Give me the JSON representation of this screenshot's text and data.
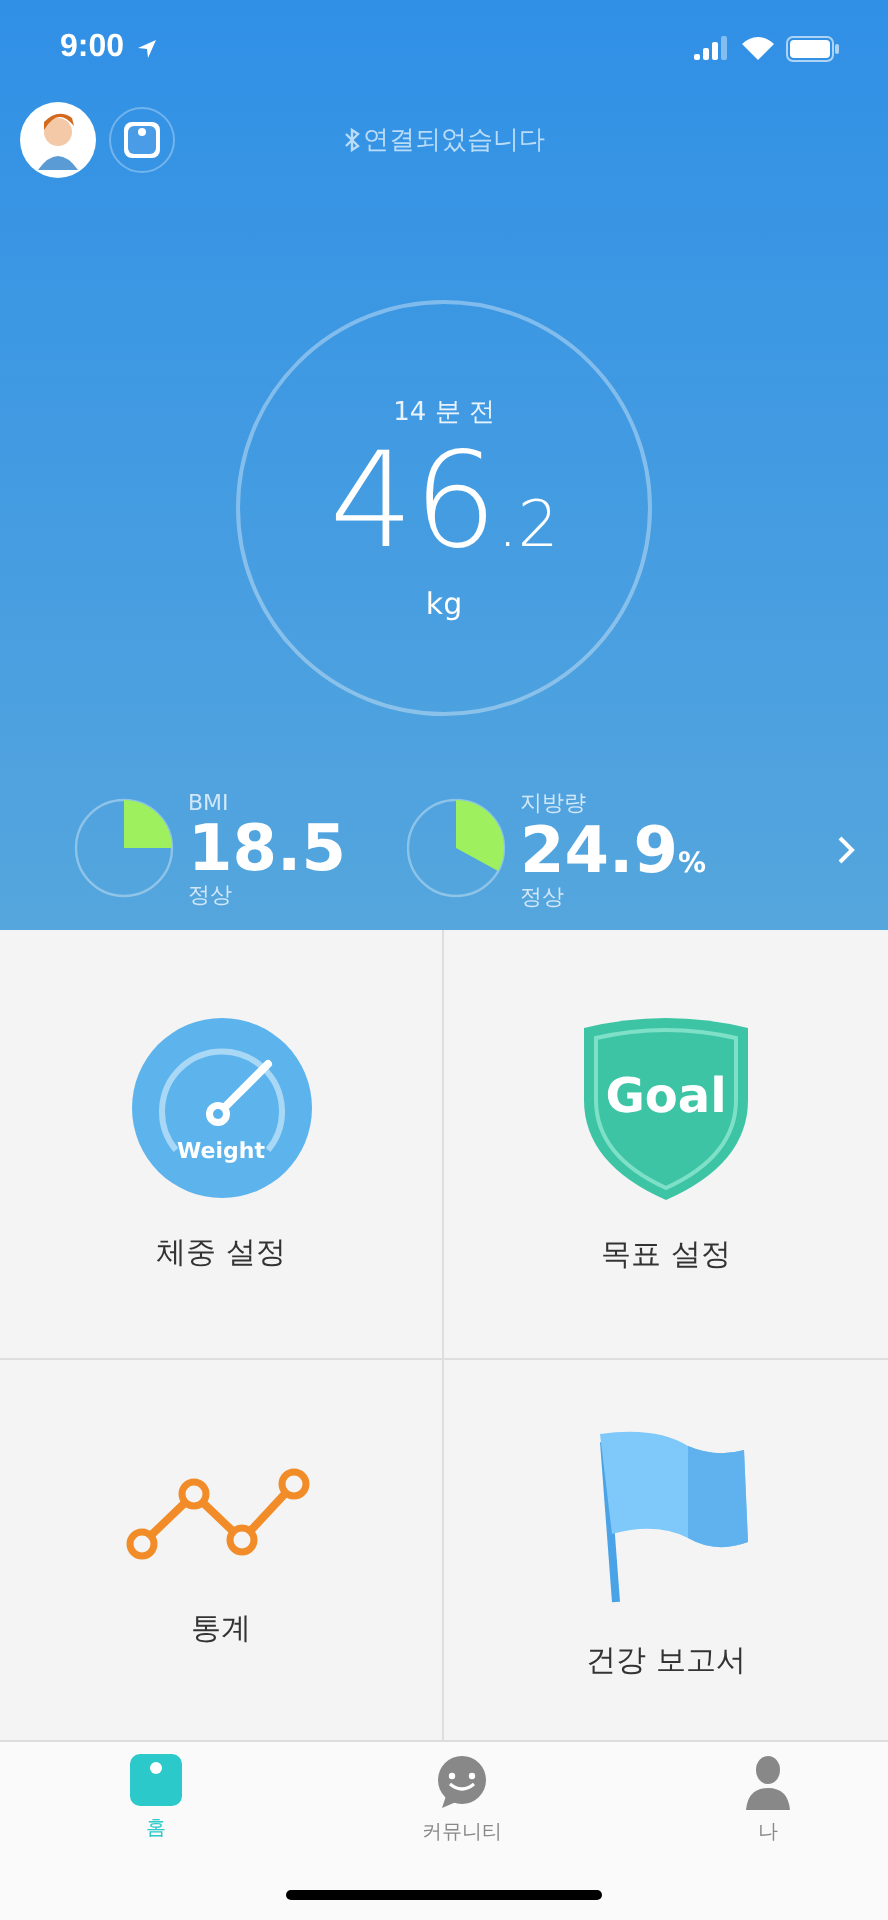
{
  "status_bar": {
    "time": "9:00"
  },
  "header": {
    "connection": "연결되었습니다"
  },
  "reading": {
    "ago": "14 분 전",
    "whole": "46",
    "fraction": ".2",
    "unit": "kg"
  },
  "metrics": [
    {
      "label": "BMI",
      "value": "18.5",
      "status": "정상"
    },
    {
      "label": "지방량",
      "value": "24.9",
      "unit": "%",
      "status": "정상"
    }
  ],
  "menu": [
    {
      "kind": "gauge",
      "badge": "Weight",
      "label": "체중 설정"
    },
    {
      "kind": "shield",
      "badge": "Goal",
      "label": "목표 설정"
    },
    {
      "kind": "chart",
      "label": "통계"
    },
    {
      "kind": "flag",
      "label": "건강 보고서"
    }
  ],
  "tabs": [
    {
      "kind": "scale",
      "label": "홈",
      "selected": true
    },
    {
      "kind": "chat",
      "label": "커뮤니티",
      "selected": false
    },
    {
      "kind": "person",
      "label": "나",
      "selected": false
    }
  ]
}
